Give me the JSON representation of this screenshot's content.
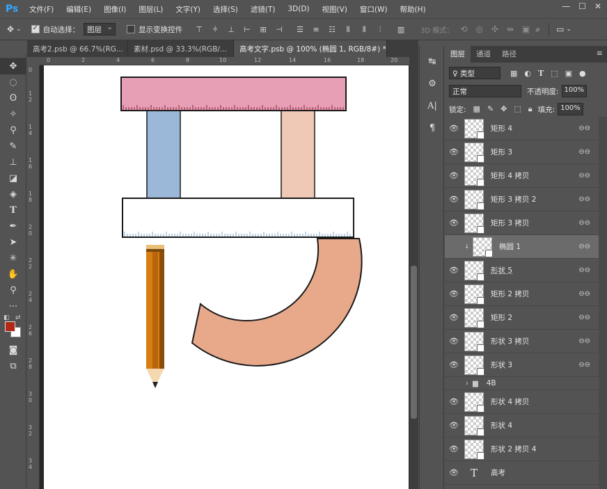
{
  "app": {
    "logo": "Ps"
  },
  "menu": [
    "文件(F)",
    "编辑(E)",
    "图像(I)",
    "图层(L)",
    "文字(Y)",
    "选择(S)",
    "滤镜(T)",
    "3D(D)",
    "视图(V)",
    "窗口(W)",
    "帮助(H)"
  ],
  "window_controls": [
    "—",
    "☐",
    "✕"
  ],
  "options": {
    "auto_select_label": "自动选择：",
    "auto_select_checked": true,
    "auto_select_target": "图层",
    "show_transform_label": "显示变换控件",
    "show_transform_checked": false,
    "mode_3d_label": "3D 模式："
  },
  "tabs": [
    {
      "label": "高考2.psb @ 66.7%(RG...",
      "active": false
    },
    {
      "label": "素材.psd @ 33.3%(RGB/...",
      "active": false
    },
    {
      "label": "高考文字.psb @ 100% (椭圆 1, RGB/8#) *",
      "active": true
    }
  ],
  "ruler": {
    "top": [
      "0",
      "2",
      "4",
      "6",
      "8",
      "10",
      "12",
      "14",
      "16",
      "18",
      "20"
    ],
    "left": [
      "0",
      "1 2",
      "1 4",
      "1 6",
      "1 8",
      "2 0",
      "2 2",
      "2 4",
      "2 6",
      "2 8",
      "3 0",
      "3 2",
      "3 4"
    ]
  },
  "artwork": {
    "ruler_top_color": "#e69fb4",
    "ruler_bottom_color": "#ffffff",
    "post_left_color": "#9bb8d8",
    "post_right_color": "#efc9b5",
    "arc_color": "#e8a98b",
    "pencil_body_color": "#d87d12",
    "pencil_ferrule_color": "#e8c078",
    "pencil_tip_color": "#f4d9b0"
  },
  "colors": {
    "foreground": "#b22718",
    "background": "#ffffff"
  },
  "layers_panel": {
    "tabs": [
      "图层",
      "通道",
      "路径"
    ],
    "filter_label": "♀ 类型",
    "blend_mode": "正常",
    "opacity_label": "不透明度:",
    "opacity_value": "100%",
    "lock_label": "锁定:",
    "fill_label": "填充:",
    "fill_value": "100%",
    "layers": [
      {
        "name": "矩形 4",
        "type": "shape",
        "linked": true,
        "selected": false
      },
      {
        "name": "矩形 3",
        "type": "shape",
        "linked": true,
        "selected": false
      },
      {
        "name": "矩形 4 拷贝",
        "type": "shape",
        "linked": true,
        "selected": false
      },
      {
        "name": "矩形 3 拷贝 2",
        "type": "shape",
        "linked": true,
        "selected": false
      },
      {
        "name": "矩形 3 拷贝",
        "type": "shape",
        "linked": true,
        "selected": false
      },
      {
        "name": "椭圆 1",
        "type": "shape",
        "linked": true,
        "selected": true,
        "clipped": true
      },
      {
        "name": "形状 5",
        "type": "shape",
        "linked": true,
        "selected": false
      },
      {
        "name": "矩形 2 拷贝",
        "type": "shape",
        "linked": true,
        "selected": false
      },
      {
        "name": "矩形 2",
        "type": "shape",
        "linked": true,
        "selected": false
      },
      {
        "name": "形状 3 拷贝",
        "type": "shape",
        "linked": true,
        "selected": false
      },
      {
        "name": "形状 3",
        "type": "shape",
        "linked": true,
        "selected": false
      },
      {
        "name": "4B",
        "type": "group",
        "linked": false,
        "selected": false
      },
      {
        "name": "形状 4 拷贝",
        "type": "shape",
        "linked": true,
        "selected": false
      },
      {
        "name": "形状 4",
        "type": "shape",
        "linked": true,
        "selected": false
      },
      {
        "name": "形状 2 拷贝 4",
        "type": "shape",
        "linked": false,
        "selected": false
      },
      {
        "name": "高考",
        "type": "text",
        "linked": false,
        "selected": false
      }
    ]
  }
}
